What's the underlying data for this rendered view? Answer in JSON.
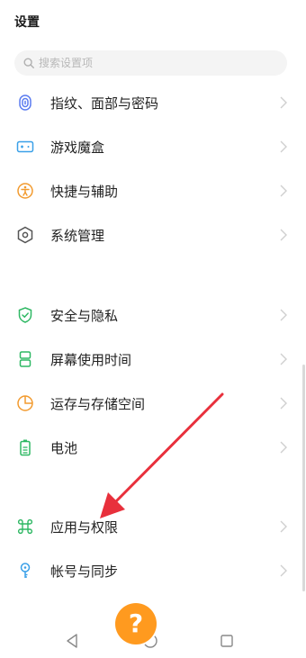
{
  "header": {
    "title": "设置"
  },
  "search": {
    "placeholder": "搜索设置项",
    "icon": "search-icon"
  },
  "group1": [
    {
      "label": "指纹、面部与密码",
      "icon": "fingerprint-icon",
      "color": "#5b7cf0"
    },
    {
      "label": "游戏魔盒",
      "icon": "gamepad-icon",
      "color": "#3aa0e8"
    },
    {
      "label": "快捷与辅助",
      "icon": "accessibility-icon",
      "color": "#f29a2e"
    },
    {
      "label": "系统管理",
      "icon": "hexagon-gear-icon",
      "color": "#555555"
    }
  ],
  "group2": [
    {
      "label": "安全与隐私",
      "icon": "shield-check-icon",
      "color": "#2fb864"
    },
    {
      "label": "屏幕使用时间",
      "icon": "hourglass-icon",
      "color": "#2fb864"
    },
    {
      "label": "运存与存储空间",
      "icon": "pie-chart-icon",
      "color": "#f29a2e"
    },
    {
      "label": "电池",
      "icon": "battery-icon",
      "color": "#2fb864"
    }
  ],
  "group3": [
    {
      "label": "应用与权限",
      "icon": "command-icon",
      "color": "#2fb864"
    },
    {
      "label": "帐号与同步",
      "icon": "key-icon",
      "color": "#3aa0e8"
    }
  ],
  "nav": {
    "back": "back-icon",
    "home": "home-icon",
    "recent": "recent-apps-icon"
  },
  "help": {
    "label": "?",
    "color": "#ff9a1f"
  },
  "annotation_arrow": {
    "color": "#e8303c"
  }
}
